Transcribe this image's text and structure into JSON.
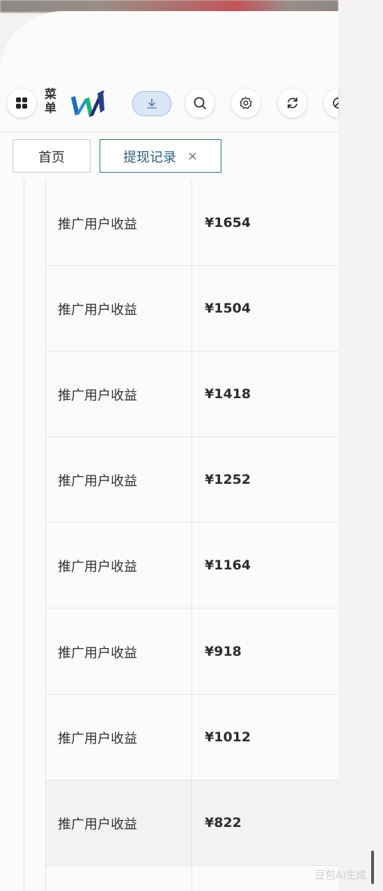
{
  "toolbar": {
    "menu_label": "菜单",
    "menu_icon": "grid-icon",
    "buttons": [
      "download-icon",
      "search-icon",
      "gear-icon",
      "refresh-icon",
      "clock-icon"
    ]
  },
  "tabs": {
    "home": "首页",
    "active": "提现记录",
    "close": "×"
  },
  "table": {
    "rows": [
      {
        "type": "推广用户收益",
        "amount": "¥1654"
      },
      {
        "type": "推广用户收益",
        "amount": "¥1504"
      },
      {
        "type": "推广用户收益",
        "amount": "¥1418"
      },
      {
        "type": "推广用户收益",
        "amount": "¥1252"
      },
      {
        "type": "推广用户收益",
        "amount": "¥1164"
      },
      {
        "type": "推广用户收益",
        "amount": "¥918"
      },
      {
        "type": "推广用户收益",
        "amount": "¥1012"
      },
      {
        "type": "推广用户收益",
        "amount": "¥822"
      }
    ]
  },
  "watermark": "豆包AI生成",
  "colors": {
    "accent": "#2d5f80",
    "download_bg": "#dbe7f6"
  }
}
